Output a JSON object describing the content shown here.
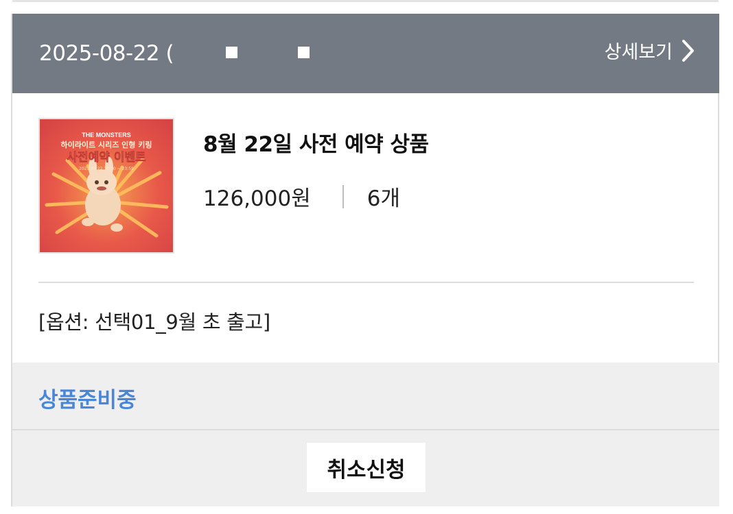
{
  "order": {
    "date_label": "2025-08-22 (",
    "detail_label": "상세보기"
  },
  "product": {
    "thumbnail": {
      "brand": "THE MONSTERS",
      "subtitle": "하이라이트 시리즈 인형 키링",
      "headline": "사전예약 이벤트",
      "date_range": "2025.08.22 10:00 ~ 23:59"
    },
    "name": "8월 22일 사전 예약 상품",
    "price": "126,000원",
    "quantity": "6개",
    "option": "[옵션: 선택01_9월 초 출고]"
  },
  "status": {
    "label": "상품준비중",
    "color": "#4a86d8"
  },
  "actions": {
    "cancel_label": "취소신청"
  },
  "colors": {
    "header_bg": "#747a84",
    "panel_bg": "#efefef",
    "thumbnail_bg": "#dc4a45"
  }
}
